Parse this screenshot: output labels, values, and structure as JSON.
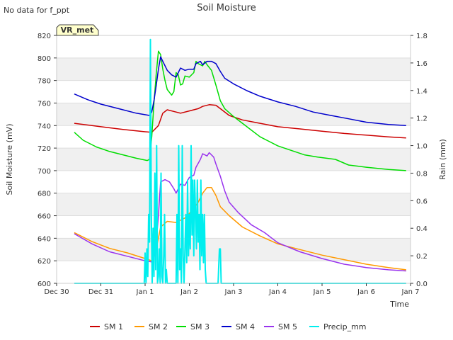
{
  "chart_data": {
    "type": "line",
    "title": "Soil Moisture",
    "note": "No data for f_ppt",
    "site_badge": "VR_met",
    "xlabel": "Time",
    "ylabel": "Soil Moisture (mV)",
    "ylabel_right": "Rain (mm)",
    "x_ticks": [
      "Dec 30",
      "Dec 31",
      "Jan 1",
      "Jan 2",
      "Jan 3",
      "Jan 4",
      "Jan 5",
      "Jan 6",
      "Jan 7"
    ],
    "xlim": [
      0,
      8
    ],
    "ylim": [
      600,
      820
    ],
    "y_ticks": [
      600,
      620,
      640,
      660,
      680,
      700,
      720,
      740,
      760,
      780,
      800,
      820
    ],
    "ylim_right": [
      0,
      1.8
    ],
    "y_ticks_right": [
      0.0,
      0.2,
      0.4,
      0.6,
      0.8,
      1.0,
      1.2,
      1.4,
      1.6,
      1.8
    ],
    "grid": true,
    "legend_position": "bottom",
    "series": [
      {
        "name": "SM 1",
        "axis": "left",
        "color": "#cc0000",
        "points": [
          [
            0.4,
            742
          ],
          [
            1.0,
            739
          ],
          [
            1.5,
            736.5
          ],
          [
            2.0,
            734.5
          ],
          [
            2.15,
            734
          ],
          [
            2.3,
            740
          ],
          [
            2.4,
            751
          ],
          [
            2.5,
            754
          ],
          [
            2.7,
            752
          ],
          [
            2.8,
            751
          ],
          [
            3.0,
            753
          ],
          [
            3.2,
            755
          ],
          [
            3.3,
            757
          ],
          [
            3.45,
            758.5
          ],
          [
            3.6,
            758
          ],
          [
            3.7,
            755
          ],
          [
            3.9,
            749
          ],
          [
            4.2,
            745
          ],
          [
            4.6,
            742
          ],
          [
            5.0,
            739
          ],
          [
            5.5,
            737
          ],
          [
            6.0,
            735
          ],
          [
            6.5,
            733
          ],
          [
            7.0,
            731.5
          ],
          [
            7.5,
            730
          ],
          [
            7.9,
            729
          ]
        ]
      },
      {
        "name": "SM 2",
        "axis": "left",
        "color": "#ff9900",
        "points": [
          [
            0.4,
            645
          ],
          [
            0.8,
            637
          ],
          [
            1.2,
            631
          ],
          [
            1.6,
            627
          ],
          [
            2.0,
            622
          ],
          [
            2.15,
            620
          ],
          [
            2.25,
            630
          ],
          [
            2.35,
            650
          ],
          [
            2.5,
            655
          ],
          [
            2.7,
            654
          ],
          [
            2.9,
            658
          ],
          [
            3.0,
            662
          ],
          [
            3.1,
            667
          ],
          [
            3.2,
            672
          ],
          [
            3.3,
            680
          ],
          [
            3.4,
            685
          ],
          [
            3.5,
            685
          ],
          [
            3.6,
            678
          ],
          [
            3.7,
            668
          ],
          [
            3.9,
            660
          ],
          [
            4.2,
            650
          ],
          [
            4.6,
            642
          ],
          [
            5.0,
            635
          ],
          [
            5.5,
            630
          ],
          [
            6.0,
            625
          ],
          [
            6.5,
            621
          ],
          [
            7.0,
            617
          ],
          [
            7.5,
            614
          ],
          [
            7.9,
            612
          ]
        ]
      },
      {
        "name": "SM 3",
        "axis": "left",
        "color": "#00dd00",
        "points": [
          [
            0.4,
            734
          ],
          [
            0.6,
            727
          ],
          [
            0.9,
            721
          ],
          [
            1.2,
            717
          ],
          [
            1.5,
            714
          ],
          [
            1.8,
            711
          ],
          [
            2.05,
            709
          ],
          [
            2.1,
            710
          ],
          [
            2.15,
            730
          ],
          [
            2.2,
            760
          ],
          [
            2.25,
            785
          ],
          [
            2.3,
            806
          ],
          [
            2.35,
            803
          ],
          [
            2.4,
            790
          ],
          [
            2.45,
            780
          ],
          [
            2.5,
            772
          ],
          [
            2.6,
            767
          ],
          [
            2.65,
            770
          ],
          [
            2.7,
            787
          ],
          [
            2.75,
            785
          ],
          [
            2.8,
            776
          ],
          [
            2.85,
            777
          ],
          [
            2.9,
            784
          ],
          [
            3.0,
            783
          ],
          [
            3.1,
            787
          ],
          [
            3.15,
            797
          ],
          [
            3.2,
            795
          ],
          [
            3.3,
            793
          ],
          [
            3.35,
            797
          ],
          [
            3.4,
            794
          ],
          [
            3.5,
            789
          ],
          [
            3.6,
            776
          ],
          [
            3.7,
            762
          ],
          [
            3.8,
            755
          ],
          [
            4.0,
            748
          ],
          [
            4.3,
            739
          ],
          [
            4.6,
            730
          ],
          [
            5.0,
            722
          ],
          [
            5.3,
            718
          ],
          [
            5.6,
            714
          ],
          [
            5.9,
            712
          ],
          [
            6.3,
            710
          ],
          [
            6.6,
            705
          ],
          [
            7.0,
            703
          ],
          [
            7.5,
            701
          ],
          [
            7.9,
            700
          ]
        ]
      },
      {
        "name": "SM 4",
        "axis": "left",
        "color": "#0000cc",
        "points": [
          [
            0.4,
            768
          ],
          [
            0.7,
            763
          ],
          [
            1.0,
            759
          ],
          [
            1.4,
            755
          ],
          [
            1.8,
            751
          ],
          [
            2.1,
            749
          ],
          [
            2.15,
            752
          ],
          [
            2.2,
            762
          ],
          [
            2.25,
            775
          ],
          [
            2.3,
            790
          ],
          [
            2.35,
            801
          ],
          [
            2.4,
            797
          ],
          [
            2.5,
            789
          ],
          [
            2.6,
            785
          ],
          [
            2.7,
            783
          ],
          [
            2.8,
            791
          ],
          [
            2.9,
            789
          ],
          [
            3.0,
            790
          ],
          [
            3.1,
            790
          ],
          [
            3.15,
            795
          ],
          [
            3.25,
            797
          ],
          [
            3.3,
            794
          ],
          [
            3.4,
            797
          ],
          [
            3.5,
            797
          ],
          [
            3.6,
            795
          ],
          [
            3.7,
            788
          ],
          [
            3.8,
            782
          ],
          [
            4.0,
            777
          ],
          [
            4.3,
            771
          ],
          [
            4.6,
            766
          ],
          [
            5.0,
            761
          ],
          [
            5.4,
            757
          ],
          [
            5.8,
            752
          ],
          [
            6.2,
            749
          ],
          [
            6.6,
            746
          ],
          [
            7.0,
            743
          ],
          [
            7.5,
            741
          ],
          [
            7.9,
            740
          ]
        ]
      },
      {
        "name": "SM 5",
        "axis": "left",
        "color": "#9933ee",
        "points": [
          [
            0.4,
            644
          ],
          [
            0.8,
            635
          ],
          [
            1.2,
            628
          ],
          [
            1.6,
            624
          ],
          [
            2.0,
            620
          ],
          [
            2.15,
            619
          ],
          [
            2.2,
            622
          ],
          [
            2.25,
            635
          ],
          [
            2.3,
            660
          ],
          [
            2.35,
            690
          ],
          [
            2.45,
            692
          ],
          [
            2.55,
            690
          ],
          [
            2.65,
            684
          ],
          [
            2.7,
            680
          ],
          [
            2.8,
            688
          ],
          [
            2.9,
            687
          ],
          [
            3.0,
            694
          ],
          [
            3.1,
            696
          ],
          [
            3.15,
            703
          ],
          [
            3.25,
            710
          ],
          [
            3.3,
            715
          ],
          [
            3.4,
            713
          ],
          [
            3.45,
            716
          ],
          [
            3.55,
            712
          ],
          [
            3.6,
            706
          ],
          [
            3.7,
            695
          ],
          [
            3.8,
            682
          ],
          [
            3.9,
            672
          ],
          [
            4.1,
            663
          ],
          [
            4.4,
            652
          ],
          [
            4.7,
            645
          ],
          [
            5.0,
            636
          ],
          [
            5.5,
            628
          ],
          [
            6.0,
            622
          ],
          [
            6.5,
            617
          ],
          [
            7.0,
            614
          ],
          [
            7.5,
            612
          ],
          [
            7.9,
            611
          ]
        ]
      },
      {
        "name": "Precip_mm",
        "axis": "right",
        "color": "#00eeee",
        "points": [
          [
            0.4,
            0
          ],
          [
            1.98,
            0
          ],
          [
            2.0,
            0.22
          ],
          [
            2.02,
            0
          ],
          [
            2.04,
            0.25
          ],
          [
            2.06,
            0.05
          ],
          [
            2.08,
            0.5
          ],
          [
            2.1,
            0.3
          ],
          [
            2.12,
            1.77
          ],
          [
            2.14,
            0.5
          ],
          [
            2.16,
            0
          ],
          [
            2.18,
            0.4
          ],
          [
            2.2,
            0.05
          ],
          [
            2.22,
            0.8
          ],
          [
            2.24,
            0.1
          ],
          [
            2.26,
            1.0
          ],
          [
            2.28,
            0
          ],
          [
            2.3,
            0.05
          ],
          [
            2.32,
            0.25
          ],
          [
            2.34,
            0
          ],
          [
            2.36,
            0.8
          ],
          [
            2.38,
            0.05
          ],
          [
            2.4,
            0
          ],
          [
            2.42,
            0.2
          ],
          [
            2.44,
            0.5
          ],
          [
            2.46,
            0
          ],
          [
            2.48,
            0.1
          ],
          [
            2.5,
            0
          ],
          [
            2.7,
            0
          ],
          [
            2.72,
            0.5
          ],
          [
            2.74,
            0
          ],
          [
            2.76,
            1.0
          ],
          [
            2.78,
            0.1
          ],
          [
            2.8,
            0.25
          ],
          [
            2.82,
            0
          ],
          [
            2.84,
            1.0
          ],
          [
            2.86,
            0.2
          ],
          [
            2.88,
            0
          ],
          [
            2.9,
            0.25
          ],
          [
            2.92,
            0.5
          ],
          [
            2.94,
            0.15
          ],
          [
            2.96,
            0.75
          ],
          [
            2.98,
            0.2
          ],
          [
            3.0,
            0.5
          ],
          [
            3.02,
            0.25
          ],
          [
            3.04,
            1.0
          ],
          [
            3.06,
            0.35
          ],
          [
            3.08,
            0.75
          ],
          [
            3.1,
            0.2
          ],
          [
            3.12,
            0.75
          ],
          [
            3.14,
            0.5
          ],
          [
            3.16,
            0.25
          ],
          [
            3.18,
            0.75
          ],
          [
            3.2,
            0.3
          ],
          [
            3.22,
            0.5
          ],
          [
            3.24,
            0.1
          ],
          [
            3.26,
            0.75
          ],
          [
            3.28,
            0.2
          ],
          [
            3.3,
            0.5
          ],
          [
            3.32,
            0.15
          ],
          [
            3.34,
            0.5
          ],
          [
            3.36,
            0.1
          ],
          [
            3.38,
            0
          ],
          [
            3.65,
            0
          ],
          [
            3.68,
            0.25
          ],
          [
            3.7,
            0.25
          ],
          [
            3.72,
            0
          ],
          [
            7.9,
            0
          ]
        ]
      }
    ]
  }
}
